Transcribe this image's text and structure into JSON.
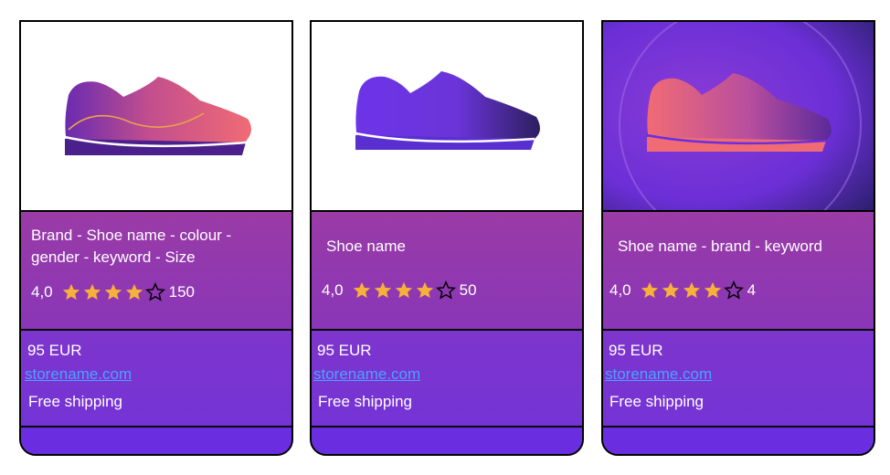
{
  "products": [
    {
      "title": "Brand - Shoe name - colour - gender  - keyword - Size",
      "rating": "4,0",
      "stars_filled": 4,
      "stars_total": 5,
      "review_count": "150",
      "price": "95 EUR",
      "store": "storename.com",
      "shipping": "Free shipping",
      "image_icon": "sneaker-icon"
    },
    {
      "title": "Shoe name",
      "rating": "4,0",
      "stars_filled": 4,
      "stars_total": 5,
      "review_count": "50",
      "price": "95 EUR",
      "store": "storename.com",
      "shipping": "Free shipping",
      "image_icon": "sneaker-icon"
    },
    {
      "title": "Shoe name - brand - keyword",
      "rating": "4,0",
      "stars_filled": 4,
      "stars_total": 5,
      "review_count": "4",
      "price": "95 EUR",
      "store": "storename.com",
      "shipping": "Free shipping",
      "image_icon": "sneaker-icon"
    }
  ],
  "colors": {
    "star": "#f6b13a",
    "link": "#4aa3ff",
    "card_info": "#9a3ba6",
    "card_offer": "#7e35cc"
  }
}
